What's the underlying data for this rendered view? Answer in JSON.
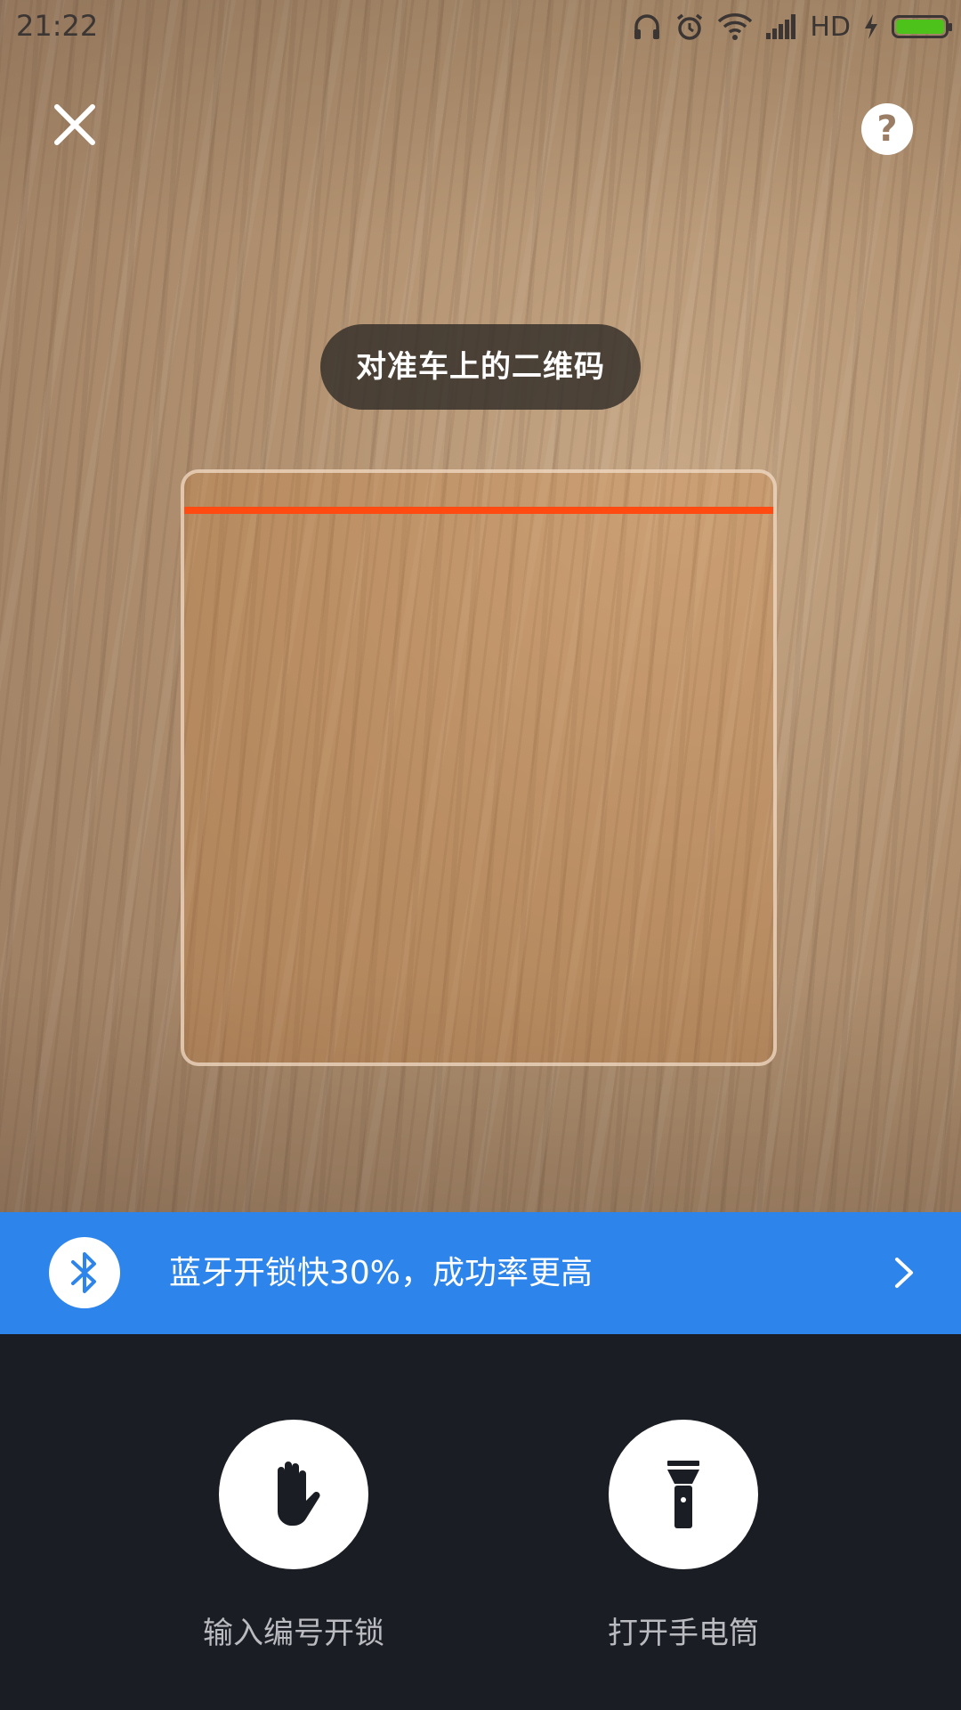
{
  "status_bar": {
    "time": "21:22",
    "network_label": "HD",
    "icons": [
      "headphones-icon",
      "alarm-icon",
      "wifi-icon",
      "signal-icon",
      "charging-icon",
      "battery-icon"
    ],
    "battery_color": "#4cc21a"
  },
  "top_bar": {
    "close_icon": "close-icon",
    "help_label": "?"
  },
  "scanner": {
    "hint": "对准车上的二维码",
    "scan_line_color": "#ff4a12"
  },
  "bluetooth_banner": {
    "text": "蓝牙开锁快30%，成功率更高",
    "icon": "bluetooth-icon",
    "background": "#2d84ea"
  },
  "actions": {
    "manual_unlock": {
      "label": "输入编号开锁",
      "icon": "hand-icon"
    },
    "flashlight": {
      "label": "打开手电筒",
      "icon": "flashlight-icon"
    }
  }
}
